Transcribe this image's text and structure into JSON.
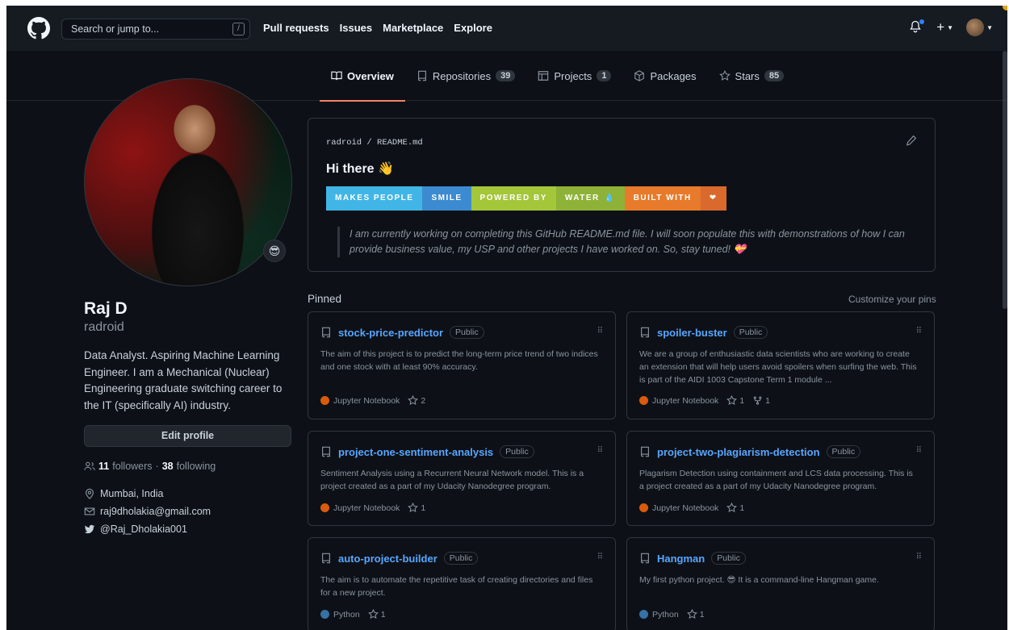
{
  "header": {
    "search_placeholder": "Search or jump to...",
    "search_shortcut": "/",
    "nav": [
      "Pull requests",
      "Issues",
      "Marketplace",
      "Explore"
    ],
    "plus_label": "+"
  },
  "tabs": [
    {
      "label": "Overview",
      "count": ""
    },
    {
      "label": "Repositories",
      "count": "39"
    },
    {
      "label": "Projects",
      "count": "1"
    },
    {
      "label": "Packages",
      "count": ""
    },
    {
      "label": "Stars",
      "count": "85"
    }
  ],
  "profile": {
    "name": "Raj D",
    "login": "radroid",
    "bio": "Data Analyst. Aspiring Machine Learning Engineer. I am a Mechanical (Nuclear) Engineering graduate switching career to the IT (specifically AI) industry.",
    "edit_label": "Edit profile",
    "followers": "11",
    "followers_label": "followers",
    "separator": "·",
    "following": "38",
    "following_label": "following",
    "location": "Mumbai, India",
    "email": "raj9dholakia@gmail.com",
    "twitter": "@Raj_Dholakia001",
    "status_emoji": "😎"
  },
  "readme": {
    "owner": "radroid",
    "slash": " / ",
    "file": "README.md",
    "greeting": "Hi there 👋",
    "badges": [
      {
        "text": "MAKES PEOPLE",
        "color": "#41b6e6"
      },
      {
        "text": "SMILE",
        "color": "#3c8bd0"
      },
      {
        "text": "POWERED BY",
        "color": "#a4c639"
      },
      {
        "text": "WATER",
        "icon": "💧",
        "color": "#8eb237"
      },
      {
        "text": "BUILT WITH",
        "color": "#e87a2b"
      },
      {
        "text": "",
        "icon": "❤",
        "color": "#d9692c"
      }
    ],
    "quote": "I am currently working on completing this GitHub README.md file. I will soon populate this with demonstrations of how I can provide business value, my USP and other projects I have worked on. So, stay tuned! 💝"
  },
  "pinned": {
    "title": "Pinned",
    "customize": "Customize your pins",
    "public_label": "Public",
    "repos": [
      {
        "name": "stock-price-predictor",
        "desc": "The aim of this project is to predict the long-term price trend of two indices and one stock with at least 90% accuracy.",
        "lang": "Jupyter Notebook",
        "lang_color": "#DA5B0B",
        "stars": "2",
        "forks": ""
      },
      {
        "name": "spoiler-buster",
        "desc": "We are a group of enthusiastic data scientists who are working to create an extension that will help users avoid spoilers when surfing the web. This is part of the AIDI 1003 Capstone Term 1 module ...",
        "lang": "Jupyter Notebook",
        "lang_color": "#DA5B0B",
        "stars": "1",
        "forks": "1"
      },
      {
        "name": "project-one-sentiment-analysis",
        "desc": "Sentiment Analysis using a Recurrent Neural Network model. This is a project created as a part of my Udacity Nanodegree program.",
        "lang": "Jupyter Notebook",
        "lang_color": "#DA5B0B",
        "stars": "1",
        "forks": ""
      },
      {
        "name": "project-two-plagiarism-detection",
        "desc": "Plagarism Detection using containment and LCS data processing. This is a project created as a part of my Udacity Nanodegree program.",
        "lang": "Jupyter Notebook",
        "lang_color": "#DA5B0B",
        "stars": "1",
        "forks": ""
      },
      {
        "name": "auto-project-builder",
        "desc": "The aim is to automate the repetitive task of creating directories and files for a new project.",
        "lang": "Python",
        "lang_color": "#3572A5",
        "stars": "1",
        "forks": ""
      },
      {
        "name": "Hangman",
        "desc": "My first python project. 😎 It is a command-line Hangman game.",
        "lang": "Python",
        "lang_color": "#3572A5",
        "stars": "1",
        "forks": ""
      }
    ]
  }
}
